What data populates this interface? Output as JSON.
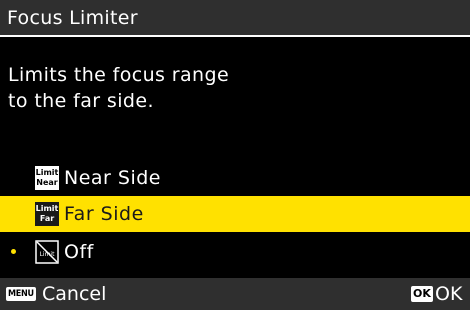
{
  "title": "Focus Limiter",
  "description": {
    "line1": "Limits the focus range",
    "line2": "to the far side."
  },
  "options": [
    {
      "label": "Near Side",
      "icon": "limit-near-icon",
      "icon_line1": "Limit",
      "icon_line2": "Near"
    },
    {
      "label": "Far Side",
      "icon": "limit-far-icon",
      "icon_line1": "Limit",
      "icon_line2": "Far",
      "highlighted": true
    },
    {
      "label": "Off",
      "icon": "limit-off-icon",
      "icon_line1": "Limit",
      "current_setting": true
    }
  ],
  "footer": {
    "menu_key": "MENU",
    "cancel_label": "Cancel",
    "ok_key": "OK",
    "ok_label": "OK"
  },
  "colors": {
    "background": "#000000",
    "bar": "#2f2f2f",
    "highlight": "#ffe100",
    "text": "#ffffff"
  }
}
